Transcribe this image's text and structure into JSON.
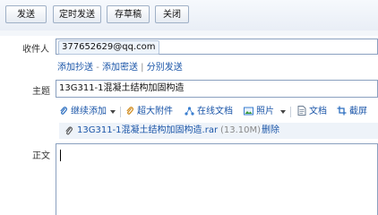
{
  "toolbar": {
    "send_label": "发送",
    "scheduled_send_label": "定时发送",
    "save_draft_label": "存草稿",
    "close_label": "关闭"
  },
  "recipient": {
    "label": "收件人",
    "value": "377652629@qq.com"
  },
  "recipient_links": {
    "add_cc": "添加抄送",
    "dash": "-",
    "add_bcc": "添加密送",
    "pipe": "|",
    "separate_send": "分别发送"
  },
  "subject": {
    "label": "主题",
    "value": "13G311-1混凝土结构加固构造"
  },
  "attach_toolbar": {
    "continue_add": "继续添加",
    "large_attachment": "超大附件",
    "online_doc": "在线文档",
    "photo": "照片",
    "document": "文档",
    "screenshot": "截屏"
  },
  "attachment": {
    "filename": "13G311-1混凝土结构加固构造.rar",
    "size": "(13.10M)",
    "delete_label": "删除"
  },
  "body": {
    "label": "正文",
    "value": ""
  },
  "colors": {
    "link": "#1a55a8",
    "border": "#8aa0bf",
    "toolbar_bg": "#e9eef6"
  },
  "icons": [
    "plus-icon",
    "dropdown-arrow-icon",
    "paperclip-icon",
    "share-icon",
    "photo-icon",
    "document-icon",
    "screenshot-icon",
    "clip-icon"
  ]
}
